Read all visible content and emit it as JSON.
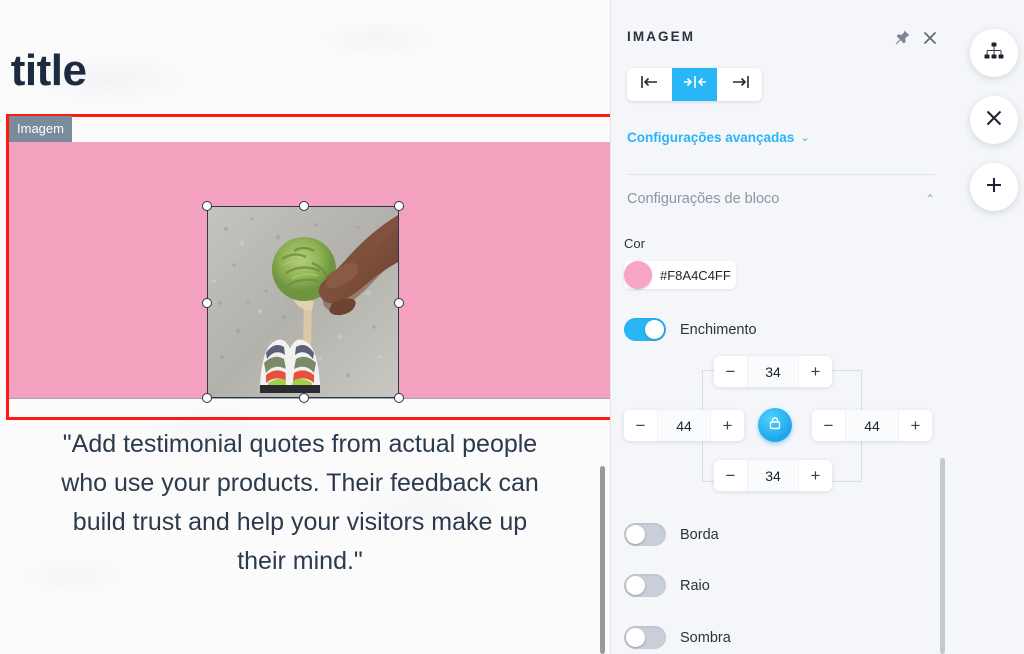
{
  "canvas": {
    "page_title": "ur title",
    "block_tag": "Imagem",
    "block_color": "#F8A4C4",
    "testimonial": "\"Add testimonial quotes from actual people who use your products. Their feedback can build trust and help your visitors make up their mind.\"",
    "selection_outline_color": "#FC1A12",
    "image_alt": "hand-holding-matcha-ice-cream"
  },
  "panel": {
    "title": "IMAGEM",
    "pin_icon": "pin-icon",
    "close_icon": "close-icon",
    "alignment": {
      "options": [
        {
          "id": "left",
          "icon": "align-left-icon",
          "active": false
        },
        {
          "id": "center",
          "icon": "align-center-icon",
          "active": true
        },
        {
          "id": "right",
          "icon": "align-right-icon",
          "active": false
        }
      ],
      "active": "center"
    },
    "advanced_settings_label": "Configurações avançadas",
    "advanced_settings_caret": "⌄",
    "block_settings_label": "Configurações de bloco",
    "block_settings_caret": "⌃",
    "color": {
      "label": "Cor",
      "value": "#F8A4C4FF",
      "swatch": "#F8A4C4"
    },
    "fill": {
      "label": "Enchimento",
      "enabled": true
    },
    "padding": {
      "top": "34",
      "right": "44",
      "bottom": "34",
      "left": "44",
      "minus": "−",
      "plus": "+",
      "lock_icon": "lock-icon",
      "locked": true
    },
    "toggles": [
      {
        "label": "Borda",
        "enabled": false
      },
      {
        "label": "Raio",
        "enabled": false
      },
      {
        "label": "Sombra",
        "enabled": false
      }
    ],
    "accent_color": "#29B6F6"
  },
  "floating_buttons": [
    {
      "id": "structure",
      "icon": "sitemap-icon"
    },
    {
      "id": "close",
      "icon": "close-icon"
    },
    {
      "id": "add",
      "icon": "plus-icon"
    }
  ]
}
